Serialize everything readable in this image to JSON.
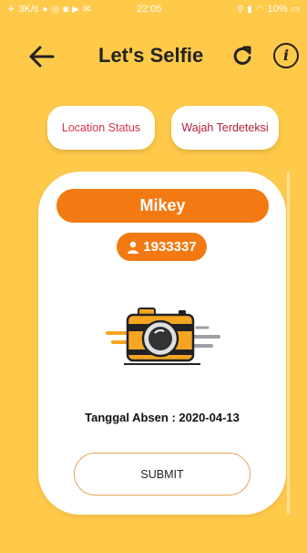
{
  "status_bar": {
    "speed": "3K/s",
    "time": "22:05",
    "battery": "10%"
  },
  "header": {
    "title": "Let's Selfie",
    "info_glyph": "i"
  },
  "chips": {
    "location_status": "Location Status",
    "face_detected": "Wajah Terdeteksi"
  },
  "card": {
    "name": "Mikey",
    "user_id": "1933337",
    "date_line": "Tanggal Absen : 2020-04-13",
    "submit_label": "SUBMIT"
  },
  "colors": {
    "background": "#FFC94A",
    "accent_orange": "#F37A13",
    "chip_text": "#D7334A"
  },
  "icons": [
    "airplane-icon",
    "wifi-icon",
    "battery-icon",
    "back-arrow-icon",
    "refresh-icon",
    "info-icon",
    "user-icon",
    "camera-icon"
  ]
}
